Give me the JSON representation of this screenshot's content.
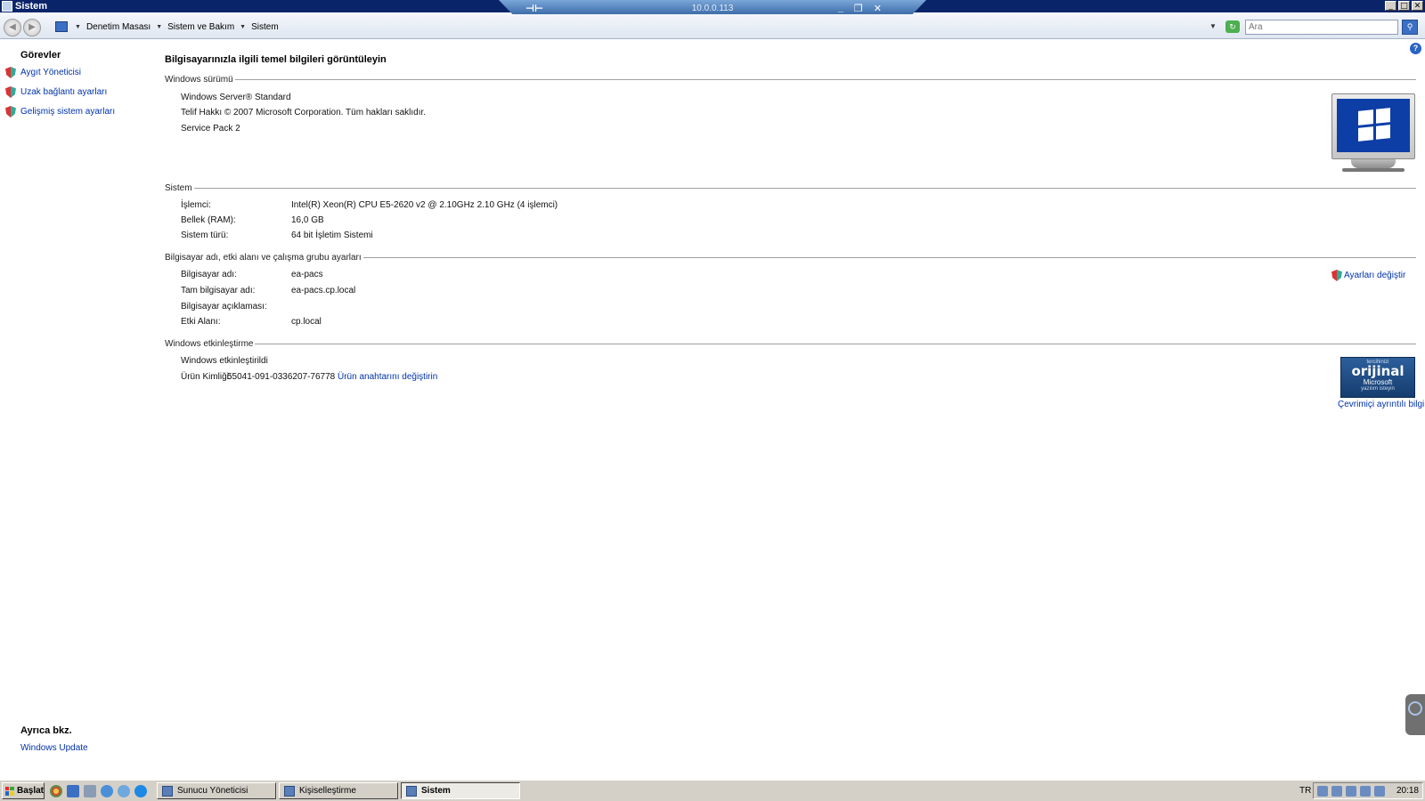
{
  "window": {
    "title": "Sistem",
    "min": "_",
    "max": "□",
    "close": "✕"
  },
  "remote_bar": {
    "host": "10.0.0.113",
    "pin": "⊣⊢",
    "min": "_",
    "restore": "❐",
    "close": "✕"
  },
  "address": {
    "segments": [
      "Denetim Masası",
      "Sistem ve Bakım",
      "Sistem"
    ],
    "search_placeholder": "Ara"
  },
  "left_pane": {
    "tasks_heading": "Görevler",
    "tasks": [
      {
        "label": "Aygıt Yöneticisi",
        "icon": "shield-icon"
      },
      {
        "label": "Uzak bağlantı ayarları",
        "icon": "shield-icon"
      },
      {
        "label": "Gelişmiş sistem ayarları",
        "icon": "shield-icon"
      }
    ],
    "see_also_heading": "Ayrıca bkz.",
    "see_also": [
      "Windows Update"
    ]
  },
  "main": {
    "title": "Bilgisayarınızla ilgili temel bilgileri görüntüleyin",
    "edition": {
      "header": "Windows sürümü",
      "name": "Windows Server® Standard",
      "copyright": "Telif Hakkı © 2007 Microsoft Corporation. Tüm hakları saklıdır.",
      "service_pack": "Service Pack 2"
    },
    "system": {
      "header": "Sistem",
      "rows": [
        {
          "label": "İşlemci:",
          "value": "Intel(R) Xeon(R) CPU E5-2620 v2 @ 2.10GHz   2.10 GHz  (4 işlemci)"
        },
        {
          "label": "Bellek (RAM):",
          "value": "16,0 GB"
        },
        {
          "label": "Sistem türü:",
          "value": "64 bit İşletim Sistemi"
        }
      ]
    },
    "computer": {
      "header": "Bilgisayar adı, etki alanı ve çalışma grubu ayarları",
      "change_settings": "Ayarları değiştir",
      "rows": [
        {
          "label": "Bilgisayar adı:",
          "value": "ea-pacs"
        },
        {
          "label": "Tam bilgisayar adı:",
          "value": "ea-pacs.cp.local"
        },
        {
          "label": "Bilgisayar açıklaması:",
          "value": ""
        },
        {
          "label": "Etki Alanı:",
          "value": "cp.local"
        }
      ]
    },
    "activation": {
      "header": "Windows etkinleştirme",
      "status": "Windows etkinleştirildi",
      "product_id_label": "Ürün Kimliği:",
      "product_id": "55041-091-0336207-76778",
      "change_key": "Ürün anahtarını değiştirin",
      "badge": {
        "top": "tercihinizi",
        "big": "orijinal",
        "mid": "Microsoft",
        "bottom": "yazılım isteyin"
      },
      "more_info": "Çevrimiçi ayrıntılı bilgi..."
    }
  },
  "taskbar": {
    "start": "Başlat",
    "windows": [
      {
        "label": "Sunucu Yöneticisi",
        "active": false
      },
      {
        "label": "Kişiselleştirme",
        "active": false
      },
      {
        "label": "Sistem",
        "active": true
      }
    ],
    "language": "TR",
    "clock": "20:18"
  },
  "colors": {
    "titlebar": "#0a246a",
    "link": "#0033aa",
    "taskbar": "#d4d0c8"
  }
}
